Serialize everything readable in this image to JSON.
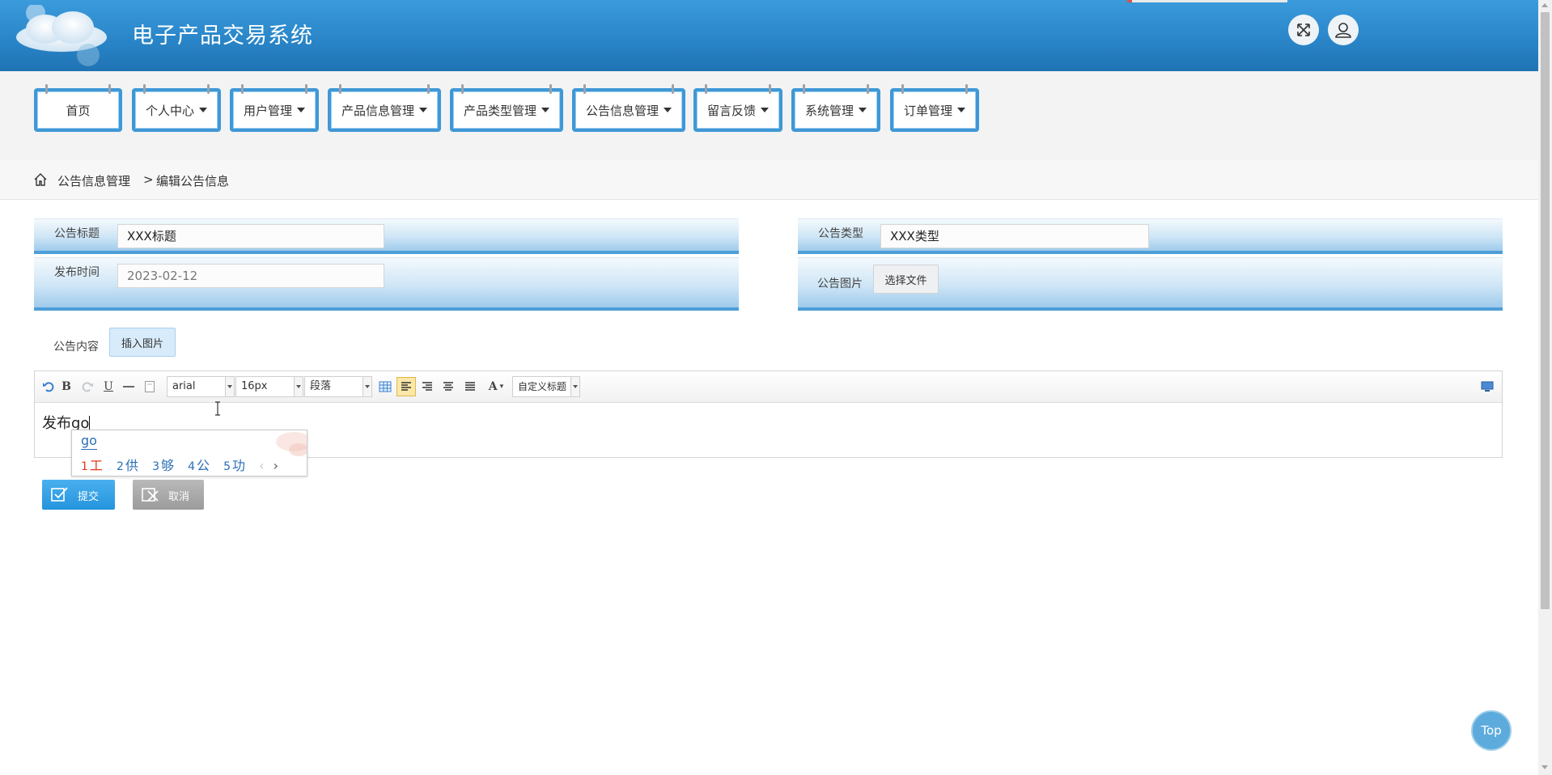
{
  "header": {
    "title": "电子产品交易系统",
    "fullscreen_icon": "expand-arrows-icon",
    "user_icon": "user-icon"
  },
  "nav": {
    "items": [
      {
        "label": "首页",
        "dropdown": false
      },
      {
        "label": "个人中心",
        "dropdown": true
      },
      {
        "label": "用户管理",
        "dropdown": true
      },
      {
        "label": "产品信息管理",
        "dropdown": true
      },
      {
        "label": "产品类型管理",
        "dropdown": true
      },
      {
        "label": "公告信息管理",
        "dropdown": true
      },
      {
        "label": "留言反馈",
        "dropdown": true
      },
      {
        "label": "系统管理",
        "dropdown": true
      },
      {
        "label": "订单管理",
        "dropdown": true
      }
    ]
  },
  "breadcrumb": {
    "icon": "home-icon",
    "section": "公告信息管理",
    "separator": ">",
    "page": "编辑公告信息"
  },
  "form": {
    "title_label": "公告标题",
    "title_value": "XXX标题",
    "type_label": "公告类型",
    "type_value": "XXX类型",
    "time_label": "发布时间",
    "time_value": "2023-02-12",
    "image_label": "公告图片",
    "choose_file": "选择文件",
    "content_label": "公告内容",
    "insert_image": "插入图片"
  },
  "editor": {
    "font_family": "arial",
    "font_size": "16px",
    "paragraph": "段落",
    "custom_heading": "自定义标题",
    "text": "发布go",
    "toolbar_icons": [
      "undo-icon",
      "bold-icon",
      "redo-icon",
      "underline-icon",
      "horizontal-rule-icon",
      "paste-icon",
      "table-icon",
      "align-left-icon",
      "align-right-icon",
      "align-center-icon",
      "justify-icon",
      "font-color-icon",
      "preview-icon"
    ]
  },
  "ime": {
    "composition": "go",
    "candidates": [
      {
        "num": "1",
        "char": "工"
      },
      {
        "num": "2",
        "char": "供"
      },
      {
        "num": "3",
        "char": "够"
      },
      {
        "num": "4",
        "char": "公"
      },
      {
        "num": "5",
        "char": "功"
      }
    ],
    "prev": "‹",
    "next": "›"
  },
  "actions": {
    "submit": "提交",
    "cancel": "取消"
  },
  "back_to_top": "Top",
  "colors": {
    "header": "#2a86c9",
    "nav_border": "#3f98d6",
    "form_border": "#4d9ed8",
    "submit": "#2594dd",
    "cancel": "#9b9b9b",
    "ime_highlight": "#e2361e"
  }
}
